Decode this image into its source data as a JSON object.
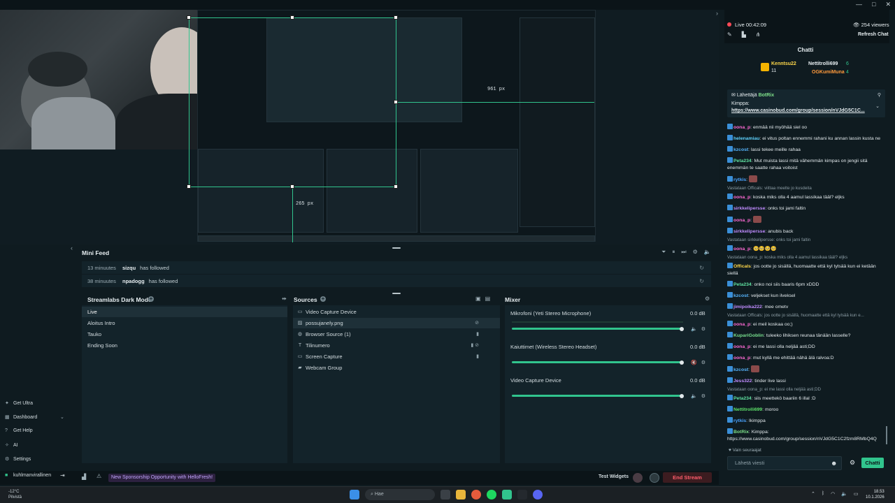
{
  "window": {
    "controls": [
      "—",
      "□",
      "✕"
    ]
  },
  "preview": {
    "measure_width": "961 px",
    "measure_height": "265 px"
  },
  "minifeed": {
    "title": "Mini Feed",
    "items": [
      {
        "time": "13 minuutes",
        "user": "sizqu",
        "action": "has followed"
      },
      {
        "time": "38 minuutes",
        "user": "npadogg",
        "action": "has followed"
      }
    ]
  },
  "scenes": {
    "title": "Streamlabs Dark Mode",
    "items": [
      "Live",
      "Aloitus Intro",
      "Tauko",
      "Ending Soon"
    ]
  },
  "sources": {
    "title": "Sources",
    "items": [
      "Video Capture Device",
      "possujanely.png",
      "Browser Source (1)",
      "Tilinumero",
      "Screen Capture",
      "Webcam Group"
    ]
  },
  "mixer": {
    "title": "Mixer",
    "channels": [
      {
        "name": "Mikrofoni (Yeti Stereo Microphone)",
        "db": "0.0 dB",
        "level": 1.0
      },
      {
        "name": "Kaiuttimet (Wireless Stereo Headset)",
        "db": "0.0 dB",
        "level": 1.0
      },
      {
        "name": "Video Capture Device",
        "db": "0.0 dB",
        "level": 1.0
      }
    ]
  },
  "nav": {
    "items": [
      "Get Ultra",
      "Dashboard",
      "Get Help",
      "AI",
      "Settings"
    ],
    "user": "kuhlmanvirallinen"
  },
  "statusbar": {
    "sponsor": "New Sponsorship Opportunity with HelloFresh!",
    "test_widgets": "Test Widgets",
    "end_stream": "End Stream"
  },
  "chat": {
    "live": "Live 00:42:09",
    "viewers": "254 viewers",
    "refresh": "Refresh Chat",
    "title": "Chatti",
    "leaderboard": [
      {
        "name": "Kenntsu22",
        "rank": "11"
      },
      {
        "name": "Nettitrolli699",
        "rank": "6"
      },
      {
        "name": "OGKumiMuna",
        "rank": "4"
      }
    ],
    "pinned_sender_label": "Lähettäjä",
    "pinned_sender": "BotRix",
    "pinned_text": "Kimppa:",
    "pinned_link": "https://www.casinobud.com/group/session/nVJdG5C1C...",
    "messages": [
      {
        "user": "oona_p",
        "color": "#ff6ad5",
        "text": "enmää nii myöhää siel oo"
      },
      {
        "user": "helenamiau",
        "color": "#5fd3ff",
        "text": "ei vitus poltan ennemmi rahani ku annan lassin kusta ne"
      },
      {
        "user": "kzcost",
        "color": "#57b6ff",
        "text": "lassi tekee meille rahaa"
      },
      {
        "user": "Peta234",
        "color": "#60e2a2",
        "text": "Mut muista lassi mitä vähemmän kimpas on jengii sitä enemmän te saatte rahaa voitoist"
      },
      {
        "user": "rytkis",
        "color": "#4aa3ff",
        "text": ""
      },
      {
        "reply": "Vastataan Officals: viittaa meelte jo kusdeita"
      },
      {
        "user": "oona_p",
        "color": "#ff6ad5",
        "text": "koska miks olla 4 aamul lassikaa tääl? eljks"
      },
      {
        "user": "sirkkelipersse",
        "color": "#c08cff",
        "text": "onks toi jami faltin"
      },
      {
        "user": "oona_p",
        "color": "#ff6ad5",
        "text": ""
      },
      {
        "user": "sirkkelipersse",
        "color": "#c08cff",
        "text": "anubis back"
      },
      {
        "reply": "Vastataan sirkkelipersse: onks toi jami faltin"
      },
      {
        "user": "oona_p",
        "color": "#ff6ad5",
        "text": "🥺🥺🥺🥺"
      },
      {
        "reply": "Vastataan oona_p: koska miks olla 4 aamul lassikaa tääl? eljks"
      },
      {
        "user": "Officals",
        "color": "#ffd84a",
        "text": "jos ootte jo sisällä, huomaatte että kyl tylsää kun ei ketään siellä"
      },
      {
        "user": "Peta234",
        "color": "#60e2a2",
        "text": "onko noi siis baaris 6pm xDDD"
      },
      {
        "user": "kzcost",
        "color": "#57b6ff",
        "text": "veljekset kun ilveksel"
      },
      {
        "user": "jimipoika222",
        "color": "#c08cff",
        "text": "mee ometv"
      },
      {
        "reply": "Vastataan Officals: jos ootte jo sisällä, huomaatte että kyl tylsää kun e..."
      },
      {
        "user": "oona_p",
        "color": "#ff6ad5",
        "text": "ei meil koskaa oo;)"
      },
      {
        "user": "KupariGoblin",
        "color": "#78e08f",
        "text": "tuleeko lihiksen reunaa tänään lasselle?"
      },
      {
        "user": "oona_p",
        "color": "#ff6ad5",
        "text": "ei me lassi olla neljää asti;DD"
      },
      {
        "user": "oona_p",
        "color": "#ff6ad5",
        "text": "mut kyllä me ehittää nähä älä ralvoa:D"
      },
      {
        "user": "kzcost",
        "color": "#57b6ff",
        "text": ""
      },
      {
        "user": "Jess322",
        "color": "#c08cff",
        "text": "tinder live lassi"
      },
      {
        "reply": "Vastataan oona_p: ei me lassi olla neljää asti;DD"
      },
      {
        "user": "Peta234",
        "color": "#60e2a2",
        "text": "siis meettekö baariin 6 illal :D"
      },
      {
        "user": "Nettitrolli699",
        "color": "#5de36a",
        "text": "moroo"
      },
      {
        "user": "rytkis",
        "color": "#4aa3ff",
        "text": "Ikimppa"
      },
      {
        "user": "BotRix",
        "color": "#7ee08a",
        "text": "Kimppa: https://www.casinobud.com/group/session/nVJdG5C1C2fzm8RMbQ4Q"
      }
    ],
    "followers_only": "Vain seuraajat",
    "input_placeholder": "Lähetä viesti",
    "send": "Chatti"
  },
  "taskbar": {
    "weather_temp": "-12°C",
    "weather_desc": "Pilvistä",
    "search": "Hae",
    "time": "18.53",
    "date": "10.1.2026"
  },
  "colors": {
    "accent": "#31c48d",
    "end_stream": "#ff5c6b",
    "live": "#ff4a57"
  }
}
